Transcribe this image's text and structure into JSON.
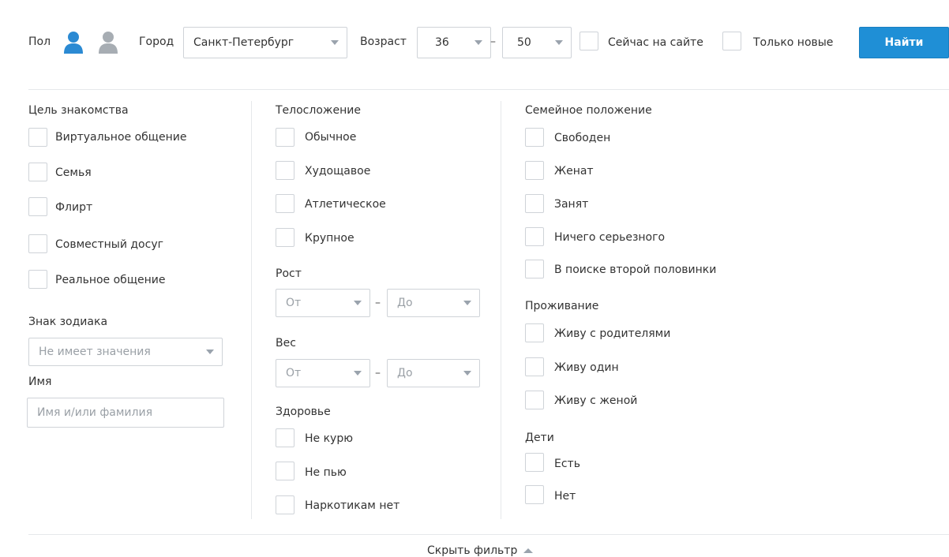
{
  "search_bar": {
    "gender_label": "Пол",
    "gender_male_icon": "user-male-icon",
    "gender_female_icon": "user-female-icon",
    "gender_male_color": "#2b8ad3",
    "gender_female_color": "#a7adb3",
    "city_label": "Город",
    "city_value": "Санкт-Петербург",
    "age_label": "Возраст",
    "age_from": "36",
    "age_to": "50",
    "age_separator": "–",
    "online_now_label": "Сейчас на сайте",
    "only_new_label": "Только новые",
    "find_button": "Найти",
    "accent_color": "#1f8fd6"
  },
  "column1": {
    "purpose_title": "Цель знакомства",
    "purpose_options": [
      "Виртуальное общение",
      "Семья",
      "Флирт",
      "Совместный досуг",
      "Реальное общение"
    ],
    "zodiac_title": "Знак зодиака",
    "zodiac_value": "Не имеет значения",
    "name_title": "Имя",
    "name_placeholder": "Имя и/или фамилия"
  },
  "column2": {
    "body_title": "Телосложение",
    "body_options": [
      "Обычное",
      "Худощавое",
      "Атлетическое",
      "Крупное"
    ],
    "height_title": "Рост",
    "height_from": "От",
    "height_to": "До",
    "weight_title": "Вес",
    "weight_from": "От",
    "weight_to": "До",
    "range_separator": "–",
    "health_title": "Здоровье",
    "health_options": [
      "Не курю",
      "Не пью",
      "Наркотикам нет"
    ]
  },
  "column3": {
    "marital_title": "Семейное положение",
    "marital_options": [
      "Свободен",
      "Женат",
      "Занят",
      "Ничего серьезного",
      "В поиске второй половинки"
    ],
    "living_title": "Проживание",
    "living_options": [
      "Живу с родителями",
      "Живу один",
      "Живу с женой"
    ],
    "children_title": "Дети",
    "children_options": [
      "Есть",
      "Нет"
    ]
  },
  "footer": {
    "hide_filter": "Скрыть фильтр",
    "chevron_icon": "chevron-up-icon"
  }
}
